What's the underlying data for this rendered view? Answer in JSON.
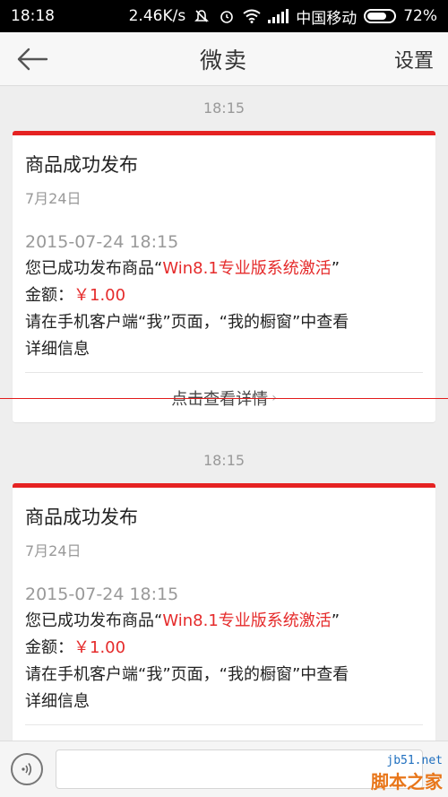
{
  "status_bar": {
    "time": "18:18",
    "speed": "2.46K/s",
    "carrier": "中国移动",
    "battery": "72%"
  },
  "nav": {
    "title": "微卖",
    "settings": "设置"
  },
  "messages": [
    {
      "time": "18:15",
      "title": "商品成功发布",
      "date": "7月24日",
      "datetime": "2015-07-24 18:15",
      "line1_prefix": "您已成功发布商品“",
      "line1_product": "Win8.1专业版系统激活",
      "line1_suffix": "”",
      "amount_label": "金额：",
      "amount_value": "￥1.00",
      "line3": "请在手机客户端“我”页面，“我的橱窗”中查看",
      "line4": "详细信息",
      "footer": "点击查看详情"
    },
    {
      "time": "18:15",
      "title": "商品成功发布",
      "date": "7月24日",
      "datetime": "2015-07-24 18:15",
      "line1_prefix": "您已成功发布商品“",
      "line1_product": "Win8.1专业版系统激活",
      "line1_suffix": "”",
      "amount_label": "金额：",
      "amount_value": "￥1.00",
      "line3": "请在手机客户端“我”页面，“我的橱窗”中查看",
      "line4": "详细信息"
    }
  ],
  "input": {
    "placeholder": ""
  },
  "watermark": {
    "url": "jb51.net",
    "name": "脚本之家"
  },
  "colors": {
    "accent_red": "#e52222",
    "status_bg": "#000000"
  }
}
